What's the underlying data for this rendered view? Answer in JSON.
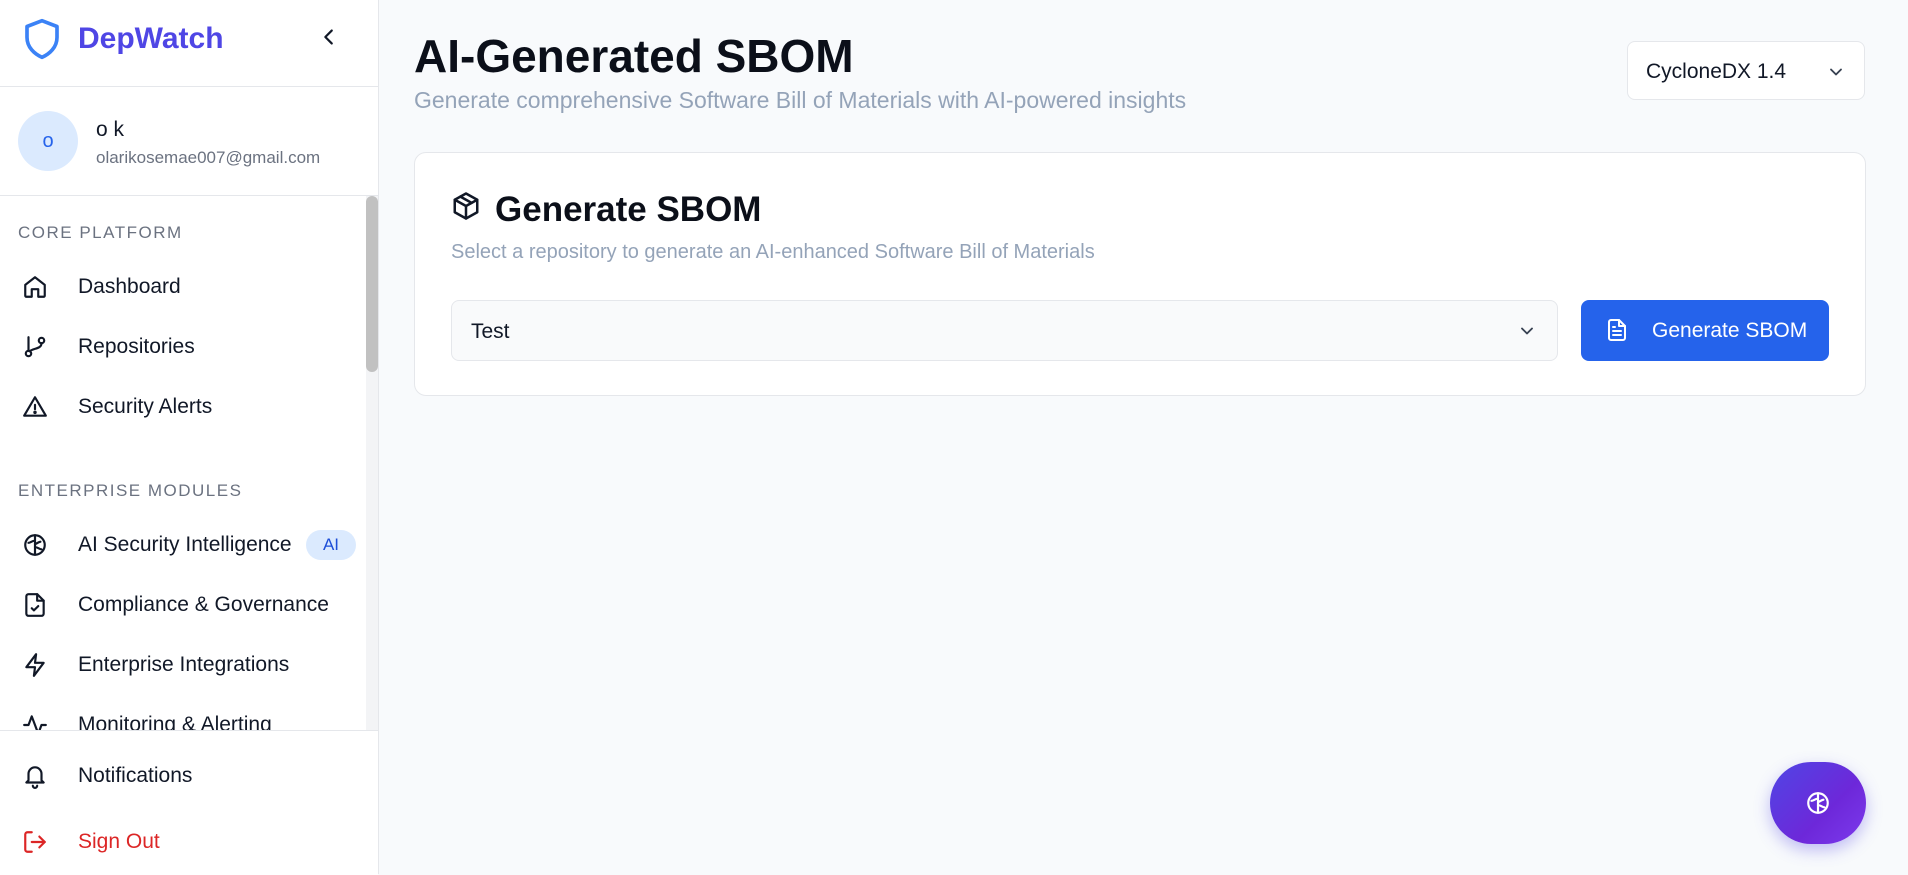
{
  "sidebar": {
    "brand": "DepWatch",
    "user": {
      "initial": "o",
      "name": "o k",
      "email": "olarikosemae007@gmail.com"
    },
    "sections": {
      "core": "CORE PLATFORM",
      "enterprise": "ENTERPRISE MODULES"
    },
    "core_items": [
      {
        "label": "Dashboard",
        "icon": "home-icon"
      },
      {
        "label": "Repositories",
        "icon": "git-branch-icon"
      },
      {
        "label": "Security Alerts",
        "icon": "alert-triangle-icon"
      }
    ],
    "enterprise_items": [
      {
        "label": "AI Security Intelligence",
        "icon": "brain-icon",
        "badge": "AI"
      },
      {
        "label": "Compliance & Governance",
        "icon": "file-check-icon"
      },
      {
        "label": "Enterprise Integrations",
        "icon": "zap-icon"
      },
      {
        "label": "Monitoring & Alerting",
        "icon": "activity-icon"
      }
    ],
    "bottom_items": [
      {
        "label": "Notifications",
        "icon": "bell-icon"
      },
      {
        "label": "Sign Out",
        "icon": "log-out-icon"
      }
    ]
  },
  "header": {
    "title": "AI-Generated SBOM",
    "subtitle": "Generate comprehensive Software Bill of Materials with AI-powered insights",
    "format_select": {
      "value": "CycloneDX 1.4"
    }
  },
  "card": {
    "title": "Generate SBOM",
    "subtitle": "Select a repository to generate an AI-enhanced Software Bill of Materials",
    "repo_select": {
      "value": "Test"
    },
    "generate_button": "Generate SBOM"
  },
  "colors": {
    "accent": "#2563eb",
    "brand": "#4f46e5",
    "danger": "#dc2626"
  }
}
